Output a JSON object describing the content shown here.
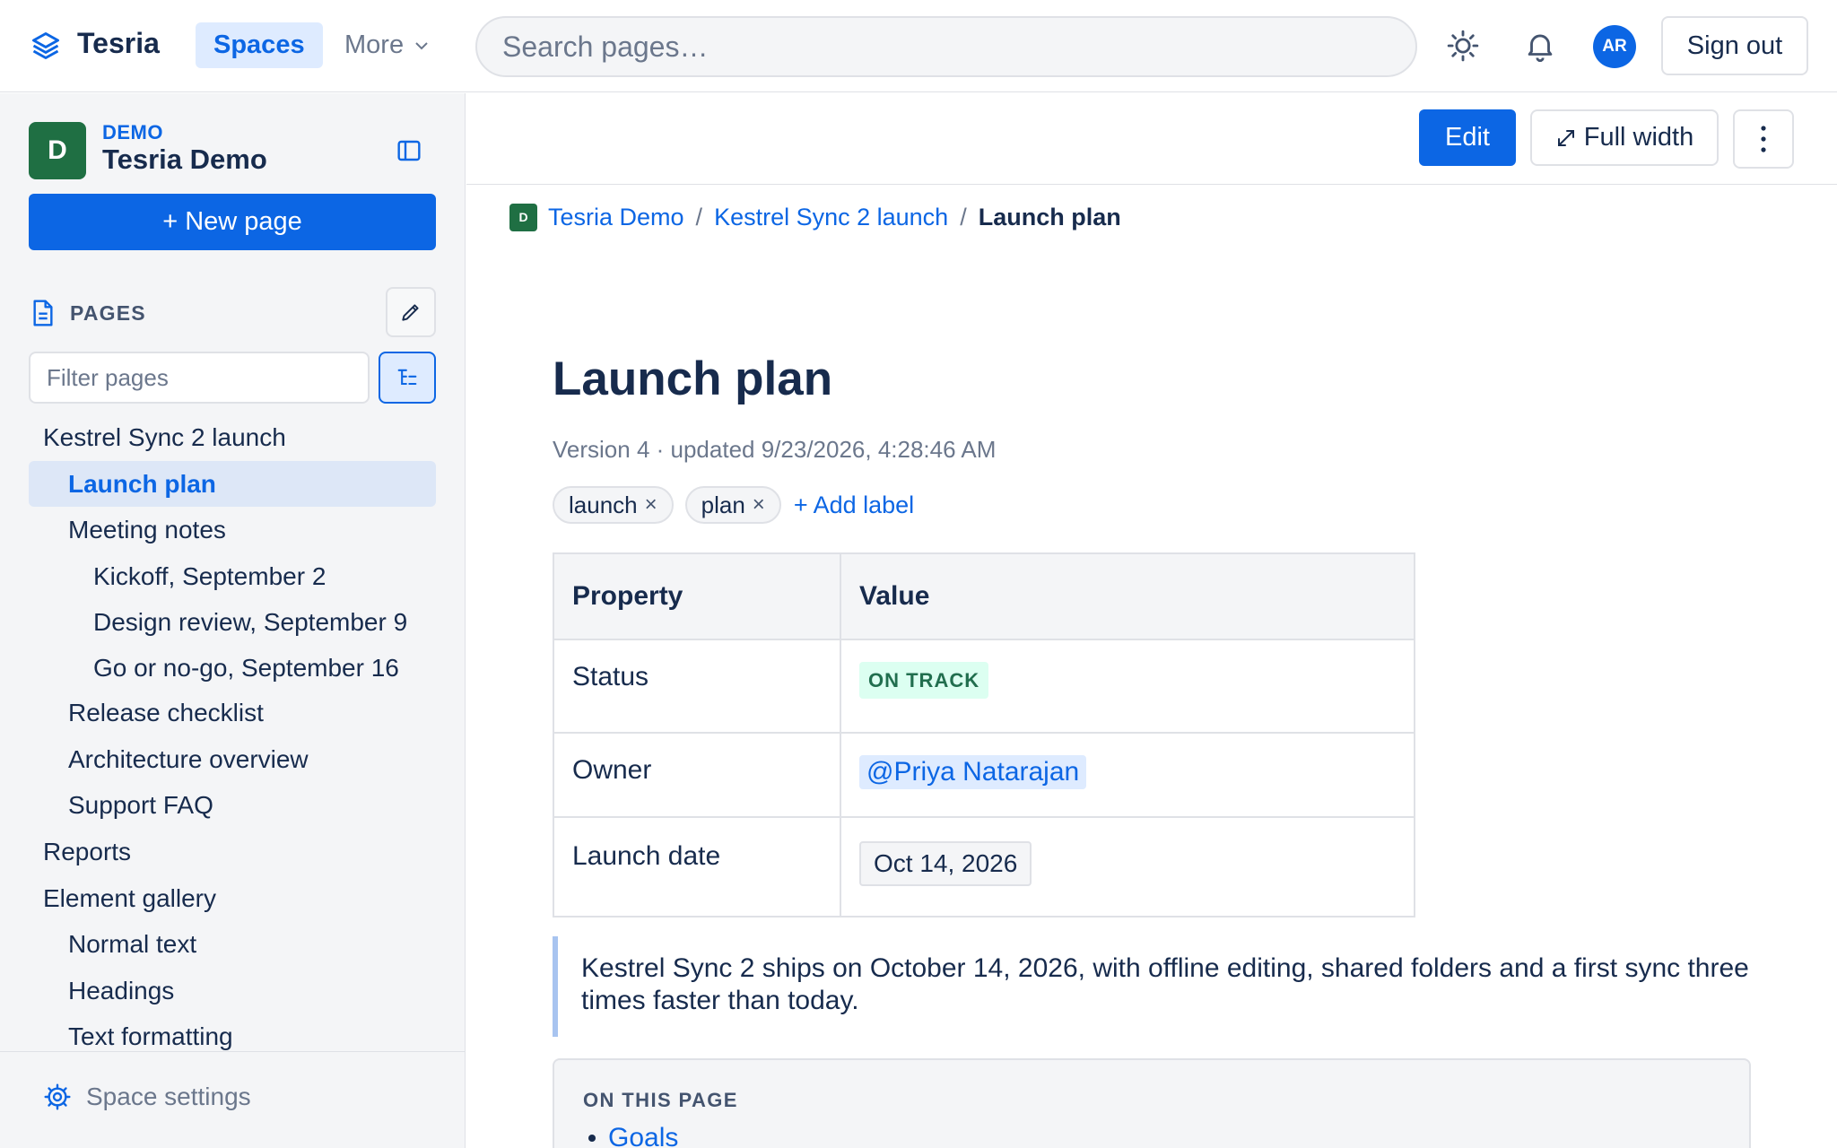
{
  "app": {
    "name": "Tesria",
    "nav": {
      "spaces": "Spaces",
      "more": "More"
    },
    "search_placeholder": "Search pages…",
    "avatar_initials": "AR",
    "sign_out": "Sign out"
  },
  "sidebar": {
    "space_avatar": "D",
    "space_key": "DEMO",
    "space_name": "Tesria Demo",
    "new_page": "+ New page",
    "pages_label": "PAGES",
    "filter_placeholder": "Filter pages",
    "tree": [
      {
        "label": "Kestrel Sync 2 launch",
        "level": 0,
        "active": false
      },
      {
        "label": "Launch plan",
        "level": 1,
        "active": true
      },
      {
        "label": "Meeting notes",
        "level": 1,
        "active": false
      },
      {
        "label": "Kickoff, September 2",
        "level": 2,
        "active": false
      },
      {
        "label": "Design review, September 9",
        "level": 2,
        "active": false
      },
      {
        "label": "Go or no-go, September 16",
        "level": 2,
        "active": false
      },
      {
        "label": "Release checklist",
        "level": 1,
        "active": false
      },
      {
        "label": "Architecture overview",
        "level": 1,
        "active": false
      },
      {
        "label": "Support FAQ",
        "level": 1,
        "active": false
      },
      {
        "label": "Reports",
        "level": 0,
        "active": false
      },
      {
        "label": "Element gallery",
        "level": 0,
        "active": false
      },
      {
        "label": "Normal text",
        "level": 1,
        "active": false
      },
      {
        "label": "Headings",
        "level": 1,
        "active": false
      },
      {
        "label": "Text formatting",
        "level": 1,
        "active": false
      }
    ],
    "settings": "Space settings"
  },
  "toolbar": {
    "edit": "Edit",
    "full_width": "Full width"
  },
  "breadcrumb": {
    "avatar": "D",
    "items": [
      "Tesria Demo",
      "Kestrel Sync 2 launch"
    ],
    "separator": "/",
    "current": "Launch plan"
  },
  "page": {
    "title": "Launch plan",
    "meta": "Version 4 · updated 9/23/2026, 4:28:46 AM",
    "labels": [
      "launch",
      "plan"
    ],
    "label_remove": "×",
    "add_label": "+ Add label",
    "properties": {
      "headers": [
        "Property",
        "Value"
      ],
      "status_label": "Status",
      "status_value": "ON TRACK",
      "owner_label": "Owner",
      "owner_value": "@Priya Natarajan",
      "date_label": "Launch date",
      "date_value": "Oct 14, 2026"
    },
    "quote": "Kestrel Sync 2 ships on October 14, 2026, with offline editing, shared folders and a first sync three times faster than today.",
    "toc": {
      "title": "ON THIS PAGE",
      "items": [
        "Goals"
      ]
    }
  },
  "colors": {
    "accent": "#0c66e4",
    "space_green": "#1f6f43",
    "status_green_bg": "#dcfff1",
    "status_green_text": "#216e4e"
  }
}
